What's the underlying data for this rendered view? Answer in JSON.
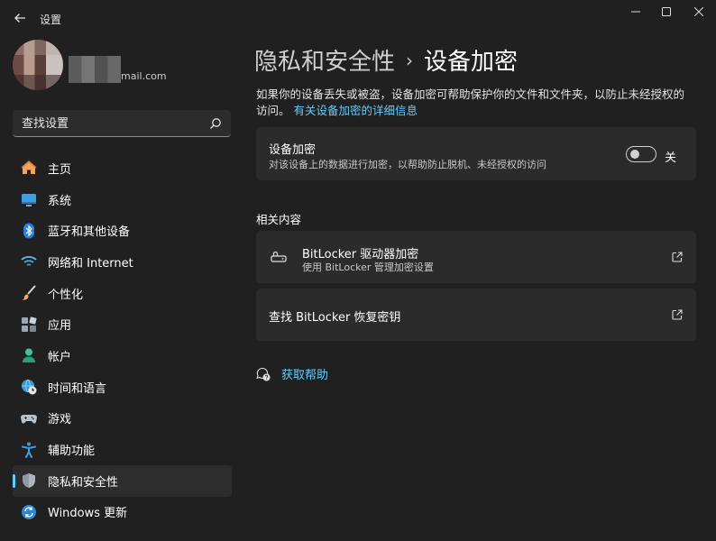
{
  "window": {
    "title": "设置"
  },
  "account": {
    "email": "mail.com"
  },
  "search": {
    "placeholder": "查找设置"
  },
  "sidebar": {
    "items": [
      {
        "label": "主页",
        "icon": "home-icon"
      },
      {
        "label": "系统",
        "icon": "system-icon"
      },
      {
        "label": "蓝牙和其他设备",
        "icon": "bluetooth-icon"
      },
      {
        "label": "网络和 Internet",
        "icon": "wifi-icon"
      },
      {
        "label": "个性化",
        "icon": "brush-icon"
      },
      {
        "label": "应用",
        "icon": "apps-icon"
      },
      {
        "label": "帐户",
        "icon": "account-icon"
      },
      {
        "label": "时间和语言",
        "icon": "globe-clock-icon"
      },
      {
        "label": "游戏",
        "icon": "gamepad-icon"
      },
      {
        "label": "辅助功能",
        "icon": "accessibility-icon"
      },
      {
        "label": "隐私和安全性",
        "icon": "shield-icon",
        "active": true
      },
      {
        "label": "Windows 更新",
        "icon": "update-icon"
      }
    ]
  },
  "breadcrumb": {
    "parent": "隐私和安全性",
    "separator": "›",
    "current": "设备加密"
  },
  "description": {
    "text": "如果你的设备丢失或被盗，设备加密可帮助保护你的文件和文件夹，以防止未经授权的访问。",
    "link": "有关设备加密的详细信息"
  },
  "encryption_card": {
    "title": "设备加密",
    "subtitle": "对该设备上的数据进行加密，以帮助防止脱机、未经授权的访问",
    "toggle_state": "关",
    "enabled": false
  },
  "related": {
    "heading": "相关内容",
    "bitlocker": {
      "title": "BitLocker 驱动器加密",
      "subtitle": "使用 BitLocker 管理加密设置"
    },
    "recovery_key": {
      "title": "查找 BitLocker 恢复密钥"
    }
  },
  "help": {
    "label": "获取帮助"
  },
  "colors": {
    "accent": "#60cdff",
    "background": "#202020",
    "card": "#2b2b2b"
  }
}
